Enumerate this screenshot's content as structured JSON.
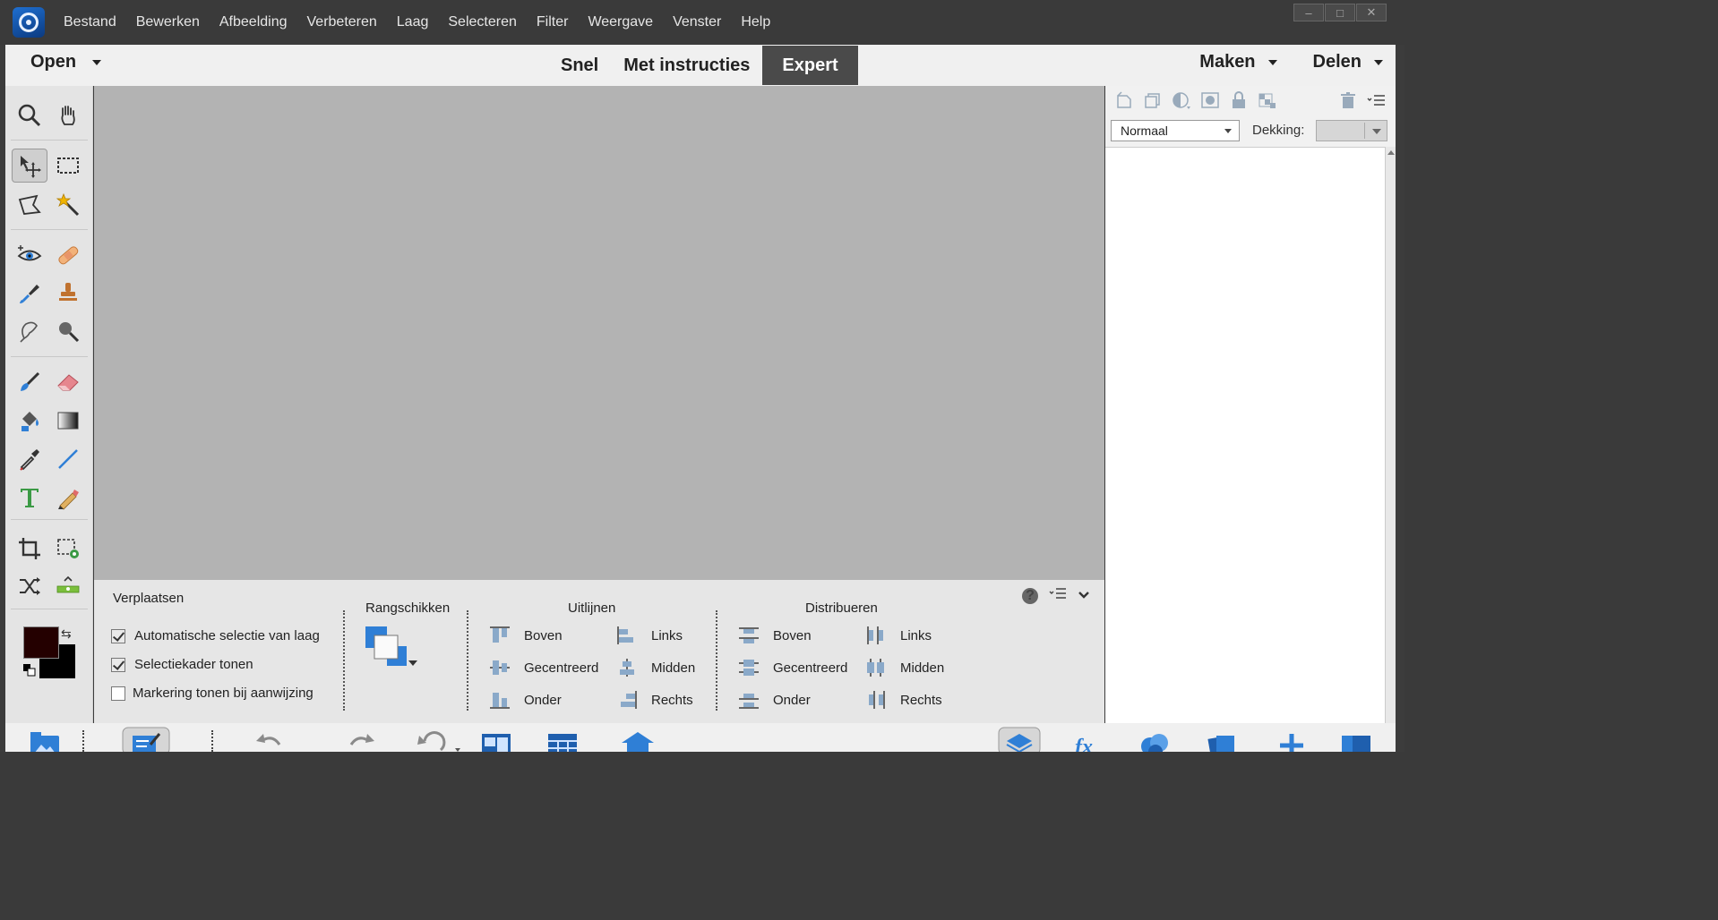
{
  "menubar": {
    "items": [
      "Bestand",
      "Bewerken",
      "Afbeelding",
      "Verbeteren",
      "Laag",
      "Selecteren",
      "Filter",
      "Weergave",
      "Venster",
      "Help"
    ],
    "window_controls": [
      "–",
      "□",
      "✕"
    ]
  },
  "modebar": {
    "open_label": "Open",
    "tabs": [
      "Snel",
      "Met instructies",
      "Expert"
    ],
    "active_tab": "Expert",
    "make_label": "Maken",
    "share_label": "Delen"
  },
  "toolbox": {
    "tools": [
      "zoom-icon",
      "hand-icon",
      "move-icon",
      "marquee-icon",
      "lasso-icon",
      "magic-wand-icon",
      "redeye-icon",
      "healing-icon",
      "smart-brush-icon",
      "clone-stamp-icon",
      "blur-icon",
      "sponge-icon",
      "brush-icon",
      "eraser-icon",
      "paint-bucket-icon",
      "gradient-icon",
      "eyedropper-icon",
      "line-icon",
      "type-icon",
      "pencil-icon",
      "crop-icon",
      "recompose-icon",
      "content-aware-move-icon",
      "straighten-icon"
    ],
    "selected_tool": "move-icon",
    "foreground_color": "#240000",
    "background_color": "#000000"
  },
  "options": {
    "title": "Verplaatsen",
    "checkboxes": [
      {
        "label": "Automatische selectie van laag",
        "checked": true
      },
      {
        "label": "Selectiekader tonen",
        "checked": true
      },
      {
        "label": "Markering tonen bij aanwijzing",
        "checked": false
      }
    ],
    "arrange_title": "Rangschikken",
    "align_title": "Uitlijnen",
    "align_items": [
      "Boven",
      "Gecentreerd",
      "Onder",
      "Links",
      "Midden",
      "Rechts"
    ],
    "distribute_title": "Distribueren",
    "distribute_items": [
      "Boven",
      "Gecentreerd",
      "Onder",
      "Links",
      "Midden",
      "Rechts"
    ],
    "help_label": "?"
  },
  "layers_panel": {
    "blend_mode": "Normaal",
    "opacity_label": "Dekking:",
    "opacity_value": ""
  },
  "colors": {
    "accent_blue": "#2f7fd6",
    "canvas_gray": "#b3b3b3",
    "menubar_bg": "#3a3a3a"
  }
}
